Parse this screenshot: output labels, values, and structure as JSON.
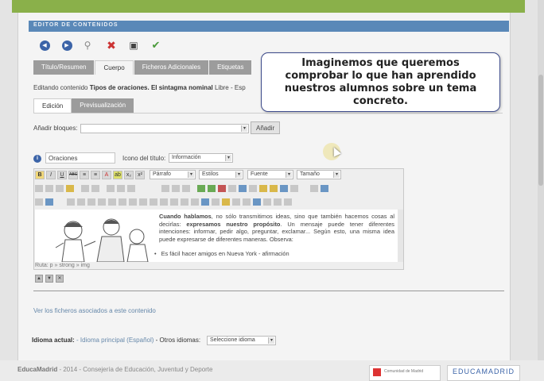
{
  "window": {
    "panel_title": "EDITOR DE CONTENIDOS"
  },
  "toolbar": {
    "icons": [
      "back-icon",
      "forward-icon",
      "search-icon",
      "delete-icon",
      "save-icon",
      "check-icon"
    ]
  },
  "tabs": [
    {
      "label": "Título/Resumen",
      "active": false
    },
    {
      "label": "Cuerpo",
      "active": true
    },
    {
      "label": "Ficheros Adicionales",
      "active": false
    },
    {
      "label": "Etiquetas",
      "active": false
    }
  ],
  "editing": {
    "prefix": "Editando contenido",
    "name": "Tipos de oraciones. El sintagma nominal",
    "suffix": "Libre - Esp"
  },
  "subtabs": [
    {
      "label": "Edición",
      "active": true
    },
    {
      "label": "Previsualización",
      "active": false
    }
  ],
  "blocks": {
    "label": "Añadir bloques:",
    "value": "",
    "button": "Añadir"
  },
  "title_row": {
    "input_value": "Oraciones",
    "icon_label": "Icono del título:",
    "icon_value": "Información"
  },
  "format_selects": [
    "Párrafo",
    "Estilos",
    "Fuente",
    "Tamaño"
  ],
  "row1_buttons": [
    "B",
    "I",
    "U",
    "ABC",
    "≡",
    "≡",
    "A",
    "ab",
    "x₂",
    "x²"
  ],
  "content": {
    "paragraph_bold1": "Cuando hablamos",
    "paragraph_1": ", no sólo transmitimos ideas, sino que también hacemos cosas al decirlas: ",
    "paragraph_bold2": "expresamos nuestro propósito",
    "paragraph_2": ". Un mensaje puede tener diferentes intenciones: informar, pedir algo, preguntar, exclamar... Según esto, una misma idea puede expresarse de diferentes maneras. Observa:",
    "bullet_1": "Es fácil hacer amigos en Nueva York - afirmación"
  },
  "path": "Ruta: p » strong » img",
  "link": "Ver los ficheros asociados a este contenido",
  "language": {
    "current_label": "Idioma actual:",
    "current_value": "- Idioma principal (Español)",
    "others_label": "- Otros idiomas:",
    "others_value": "Seleccione idioma"
  },
  "footer": {
    "brand": "EducaMadrid",
    "text": "- 2014 - Consejería de Educación, Juventud y Deporte",
    "logo1": "Comunidad de Madrid",
    "logo2": "EDUCAMADRID"
  },
  "overlay": {
    "text": "Imaginemos que queremos comprobar lo que han aprendido nuestros alumnos sobre un tema concreto."
  },
  "colors": {
    "green_bar": "#8ab04a",
    "title_blue": "#5a88b8",
    "tab_gray": "#9c9c9c",
    "link_blue": "#6688aa"
  }
}
